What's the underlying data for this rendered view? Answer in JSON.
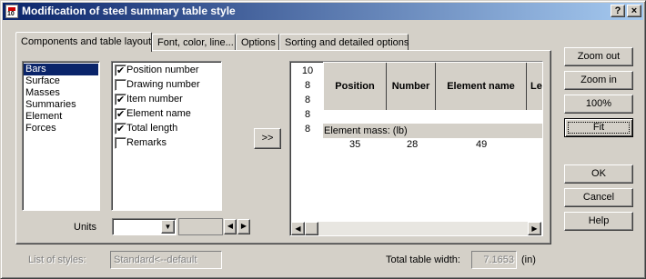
{
  "window": {
    "title": "Modification of steel summary table style",
    "help_btn": "?",
    "close_btn": "×"
  },
  "tabs": [
    {
      "label": "Components and table layout"
    },
    {
      "label": "Font, color, line..."
    },
    {
      "label": "Options"
    },
    {
      "label": "Sorting and detailed options"
    }
  ],
  "components": {
    "items": [
      "Bars",
      "Surface",
      "Masses",
      "Summaries",
      "Element",
      "Forces"
    ],
    "selected": "Bars"
  },
  "columns_options": [
    {
      "label": "Position number",
      "checked": true
    },
    {
      "label": "Drawing number",
      "checked": false
    },
    {
      "label": "Item number",
      "checked": true
    },
    {
      "label": "Element name",
      "checked": true
    },
    {
      "label": "Total length",
      "checked": true
    },
    {
      "label": "Remarks",
      "checked": false
    }
  ],
  "units": {
    "label": "Units",
    "value": ""
  },
  "move_button": ">>",
  "preview": {
    "row_heights": [
      "10",
      "8",
      "8",
      "8",
      "8"
    ],
    "headers": [
      "Position",
      "Number",
      "Element name",
      "Le"
    ],
    "mass_label": "Element mass: (lb)",
    "mass_values": [
      "35",
      "28",
      "49"
    ]
  },
  "side_buttons": {
    "zoom_out": "Zoom out",
    "zoom_in": "Zoom in",
    "zoom_100": "100%",
    "fit": "Fit",
    "ok": "OK",
    "cancel": "Cancel",
    "help": "Help"
  },
  "footer": {
    "styles_label": "List of styles:",
    "styles_value": "Standard<--default",
    "width_label": "Total table width:",
    "width_value": "7.1653",
    "width_unit": "(in)"
  }
}
